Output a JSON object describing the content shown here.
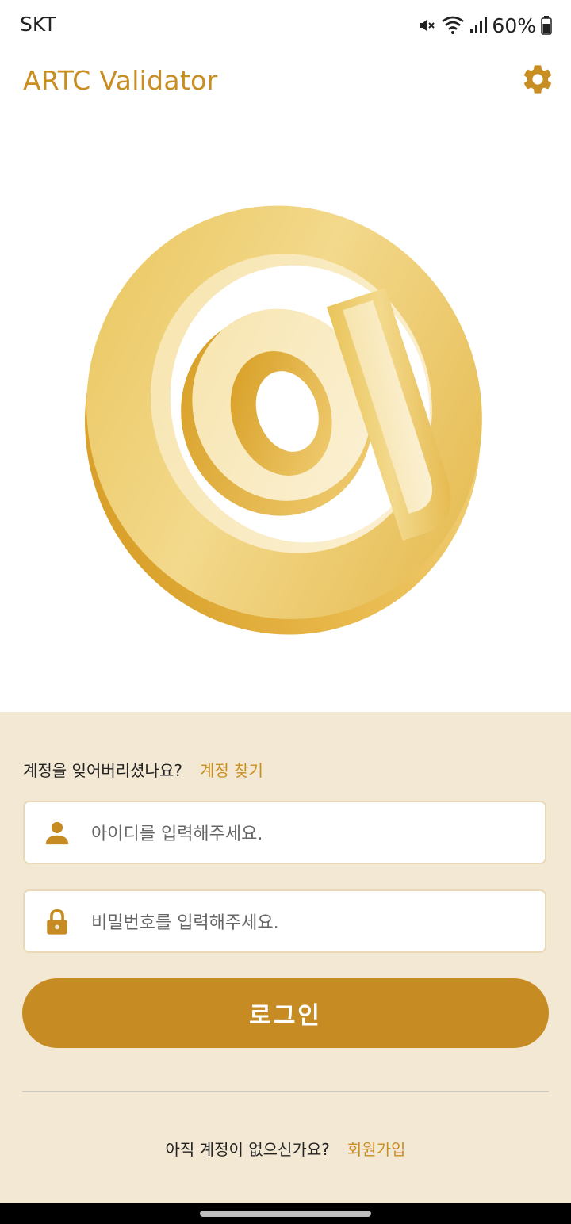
{
  "status_bar": {
    "carrier": "SKT",
    "battery": "60%",
    "icons": [
      "mute-icon",
      "wifi-icon",
      "signal-icon",
      "battery-icon"
    ]
  },
  "header": {
    "title": "ARTC Validator",
    "settings_icon": "gear-icon"
  },
  "hero": {
    "icon": "at-sign-3d"
  },
  "login": {
    "forgot_text": "계정을 잊어버리셨나요?",
    "forgot_link": "계정 찾기",
    "id_placeholder": "아이디를 입력해주세요.",
    "id_value": "",
    "password_placeholder": "비밀번호를 입력해주세요.",
    "password_value": "",
    "login_label": "로그인",
    "signup_text": "아직 계정이 없으신가요?",
    "signup_link": "회원가입"
  },
  "colors": {
    "accent": "#c98e22",
    "panel_background": "#f3e8d4",
    "button": "#c68b22"
  }
}
